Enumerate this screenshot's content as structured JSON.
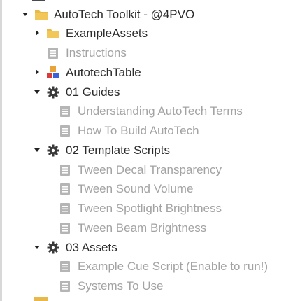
{
  "explorer": {
    "items": [
      {
        "label": "AutoTech Toolkit - @4PVO",
        "icon": "folder-icon",
        "expanded": true,
        "disabled": false
      },
      {
        "label": "ExampleAssets",
        "icon": "folder-icon",
        "expanded": false,
        "disabled": false
      },
      {
        "label": "Instructions",
        "icon": "script-icon",
        "disabled": true
      },
      {
        "label": "AutotechTable",
        "icon": "model-icon",
        "expanded": false,
        "disabled": false
      },
      {
        "label": "01 Guides",
        "icon": "gear-icon",
        "expanded": true,
        "disabled": false
      },
      {
        "label": "Understanding AutoTech Terms",
        "icon": "script-icon",
        "disabled": true
      },
      {
        "label": "How To Build AutoTech",
        "icon": "script-icon",
        "disabled": true
      },
      {
        "label": "02 Template Scripts",
        "icon": "gear-icon",
        "expanded": true,
        "disabled": false
      },
      {
        "label": "Tween Decal Transparency",
        "icon": "script-icon",
        "disabled": true
      },
      {
        "label": "Tween Sound Volume",
        "icon": "script-icon",
        "disabled": true
      },
      {
        "label": "Tween Spotlight Brightness",
        "icon": "script-icon",
        "disabled": true
      },
      {
        "label": "Tween Beam Brightness",
        "icon": "script-icon",
        "disabled": true
      },
      {
        "label": "03 Assets",
        "icon": "gear-icon",
        "expanded": true,
        "disabled": false
      },
      {
        "label": "Example Cue Script (Enable to run!)",
        "icon": "script-icon",
        "disabled": true
      },
      {
        "label": "Systems To Use",
        "icon": "script-icon",
        "disabled": true
      }
    ]
  },
  "colors": {
    "folder": "#e8b84a",
    "script_disabled": "#a8a8a8",
    "gear": "#3a3a3a",
    "text": "#2b2b2b",
    "text_disabled": "#a3a3a3"
  }
}
